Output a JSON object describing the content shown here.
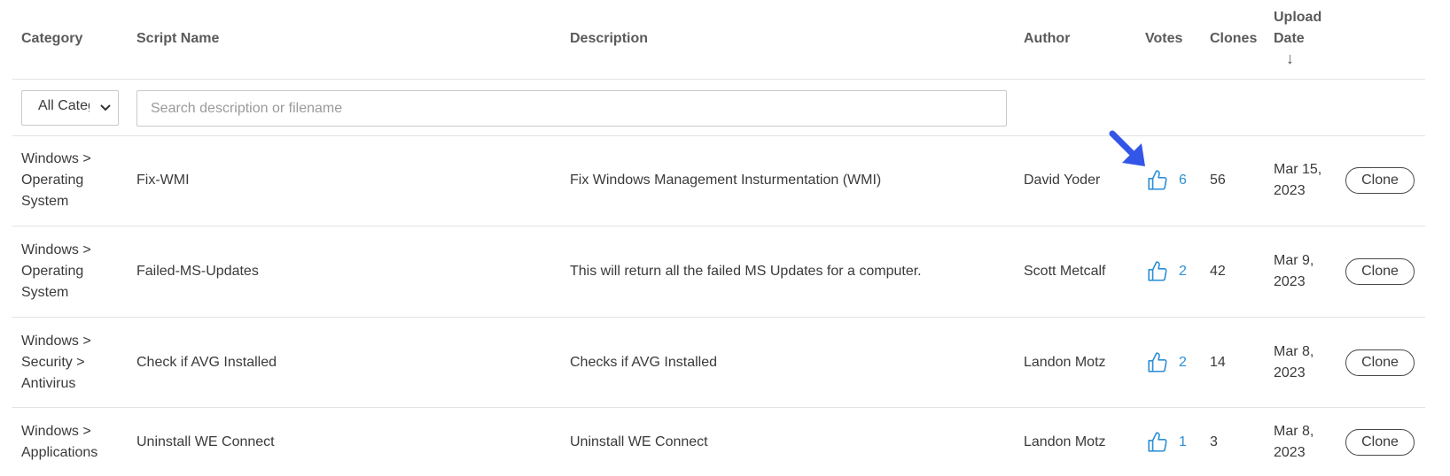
{
  "headers": {
    "category": "Category",
    "script_name": "Script Name",
    "description": "Description",
    "author": "Author",
    "votes": "Votes",
    "clones": "Clones",
    "upload_date_line1": "Upload",
    "upload_date_line2": "Date",
    "sort_arrow": "↓"
  },
  "filters": {
    "category_select_value": "All Categories",
    "search_placeholder": "Search description or filename"
  },
  "rows": [
    {
      "category": [
        "Windows >",
        "Operating",
        "System"
      ],
      "script_name": "Fix-WMI",
      "description": "Fix Windows Management Insturmentation (WMI)",
      "author": "David Yoder",
      "votes": "6",
      "clones": "56",
      "date": [
        "Mar 15,",
        "2023"
      ],
      "clone_label": "Clone"
    },
    {
      "category": [
        "Windows >",
        "Operating",
        "System"
      ],
      "script_name": "Failed-MS-Updates",
      "description": "This will return all the failed MS Updates for a computer.",
      "author": "Scott Metcalf",
      "votes": "2",
      "clones": "42",
      "date": [
        "Mar 9,",
        "2023"
      ],
      "clone_label": "Clone"
    },
    {
      "category": [
        "Windows >",
        "Security >",
        "Antivirus"
      ],
      "script_name": "Check if AVG Installed",
      "description": "Checks if AVG Installed",
      "author": "Landon Motz",
      "votes": "2",
      "clones": "14",
      "date": [
        "Mar 8,",
        "2023"
      ],
      "clone_label": "Clone"
    },
    {
      "category": [
        "Windows >",
        "Applications"
      ],
      "script_name": "Uninstall WE Connect",
      "description": "Uninstall WE Connect",
      "author": "Landon Motz",
      "votes": "1",
      "clones": "3",
      "date": [
        "Mar 8,",
        "2023"
      ],
      "clone_label": "Clone"
    }
  ],
  "icons": {
    "vote": "thumbs-up-icon",
    "select_caret": "chevron-down-icon",
    "annotation": "annotation-arrow"
  },
  "colors": {
    "accent": "#2d8fd6",
    "annotation_arrow": "#3355e8"
  }
}
